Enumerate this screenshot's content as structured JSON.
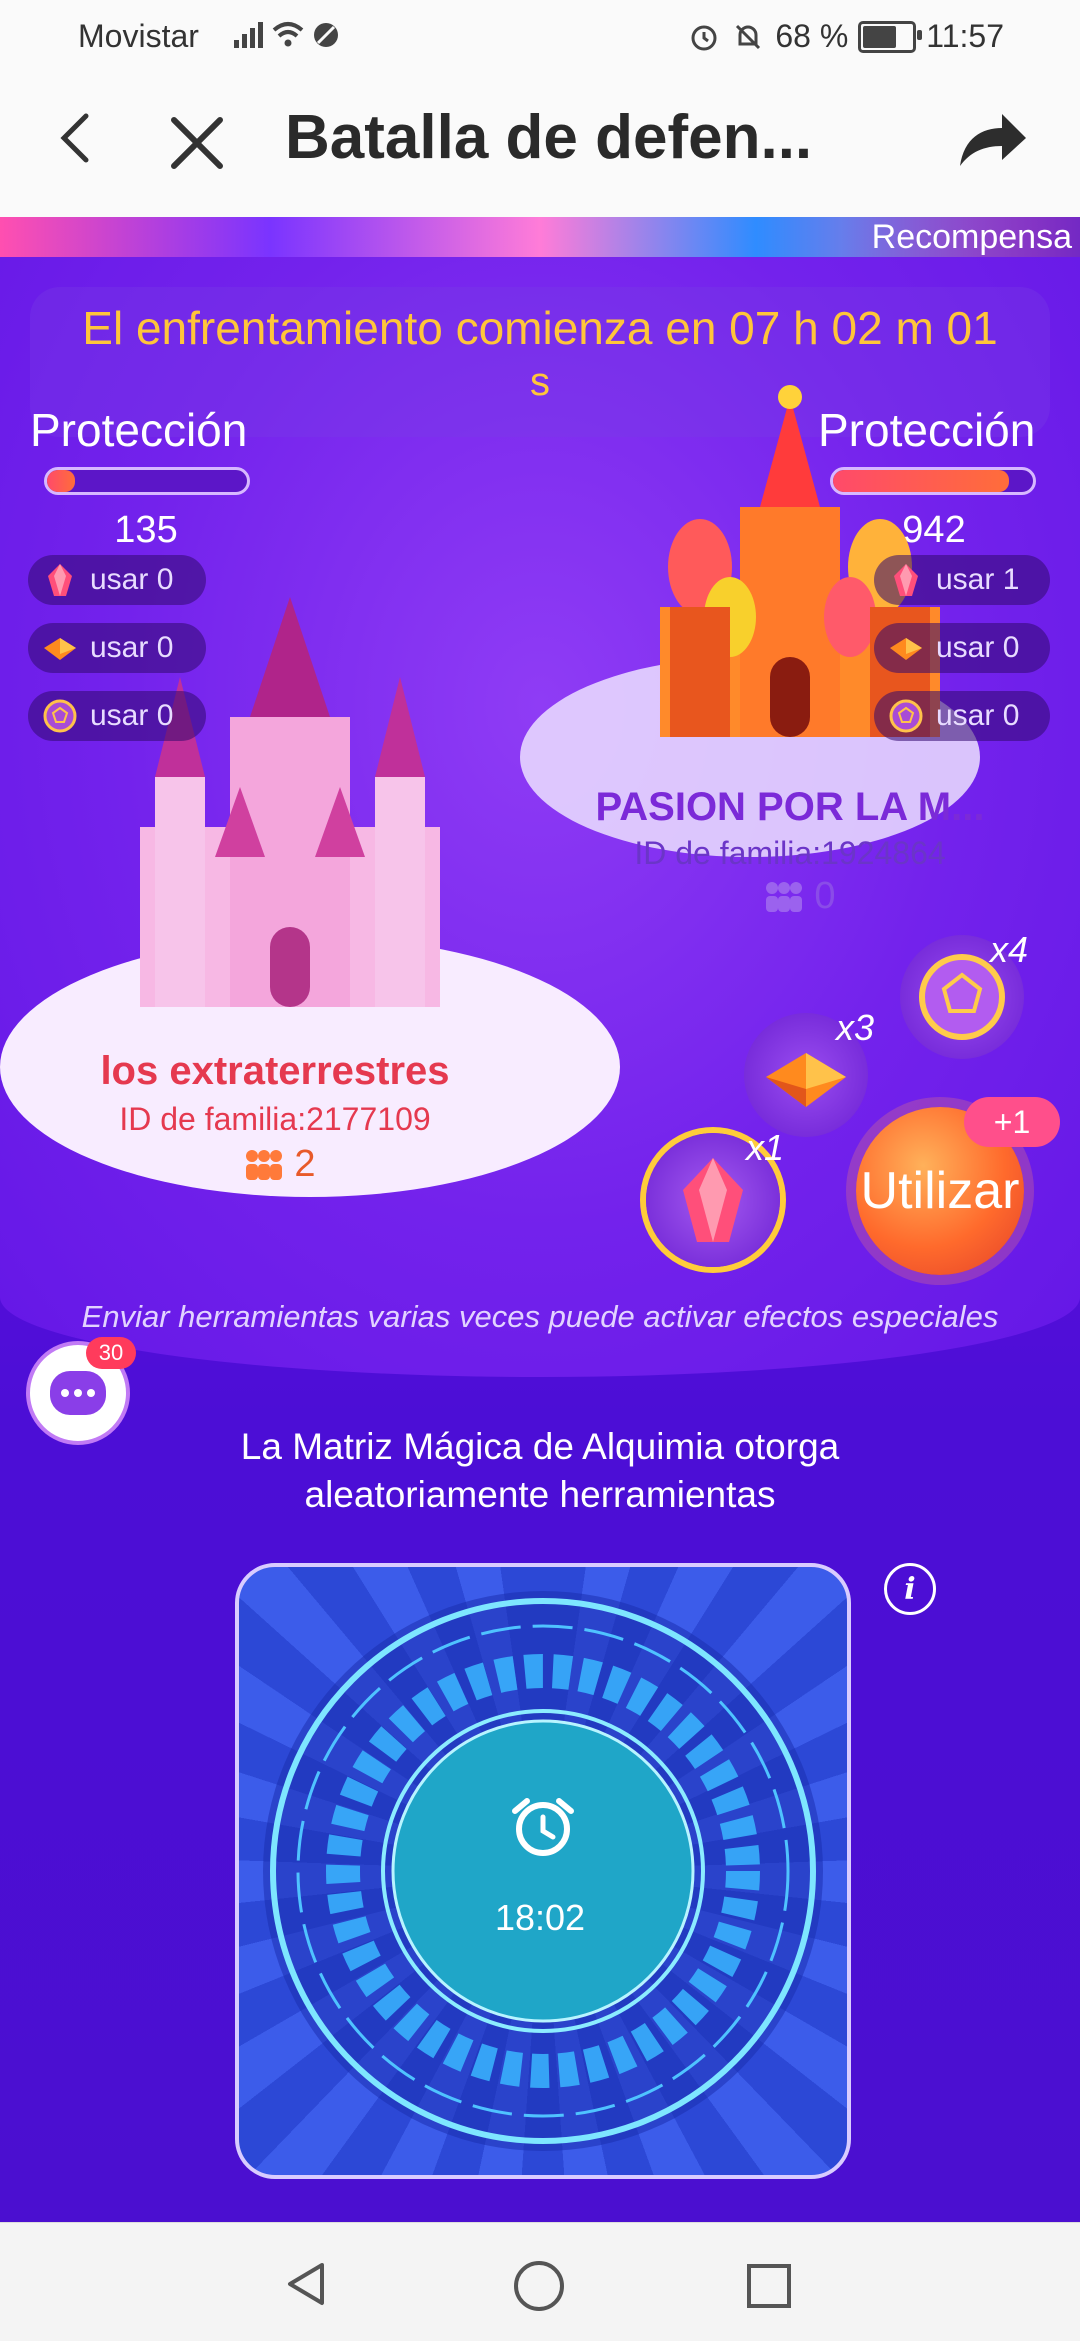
{
  "status_bar": {
    "carrier": "Movistar",
    "battery": "68 %",
    "time": "11:57"
  },
  "title_bar": {
    "title": "Batalla de defen..."
  },
  "game": {
    "reward_label": "Recompensa",
    "countdown_line1": "El enfrentamiento comienza en 07 h 02 m 01",
    "countdown_line2": "s",
    "left_team": {
      "protection_label": "Protección",
      "protection_fraction": 0.14,
      "score": "135",
      "items": [
        {
          "icon": "crystal-icon",
          "label": "usar 0"
        },
        {
          "icon": "book-icon",
          "label": "usar 0"
        },
        {
          "icon": "shield-ball-icon",
          "label": "usar 0"
        }
      ],
      "name": "los extraterrestres",
      "family_id": "ID de familia:2177109",
      "members": "2"
    },
    "right_team": {
      "protection_label": "Protección",
      "protection_fraction": 0.88,
      "score": "942",
      "items": [
        {
          "icon": "crystal-icon",
          "label": "usar 1"
        },
        {
          "icon": "book-icon",
          "label": "usar 0"
        },
        {
          "icon": "shield-ball-icon",
          "label": "usar 0"
        }
      ],
      "name": "PASION POR LA M...",
      "family_id": "ID de familia:1924864",
      "members": "0"
    },
    "tools": [
      {
        "icon": "shield-ball-icon",
        "count": "x4"
      },
      {
        "icon": "book-icon",
        "count": "x3"
      },
      {
        "icon": "crystal-icon",
        "count": "x1"
      }
    ],
    "use_button": "Utilizar",
    "use_badge": "+1",
    "hint": "Enviar herramientas varias veces puede activar efectos especiales",
    "chat_badge": "30",
    "matrix_title_line1": "La Matriz Mágica de Alquimia otorga",
    "matrix_title_line2": "aleatoriamente herramientas",
    "timer": "18:02"
  },
  "colors": {
    "accent_orange": "#ffc53a",
    "left_team_name": "#e5394f",
    "right_team_name": "#7b2ad8",
    "bg_purple": "#6a15e9"
  }
}
